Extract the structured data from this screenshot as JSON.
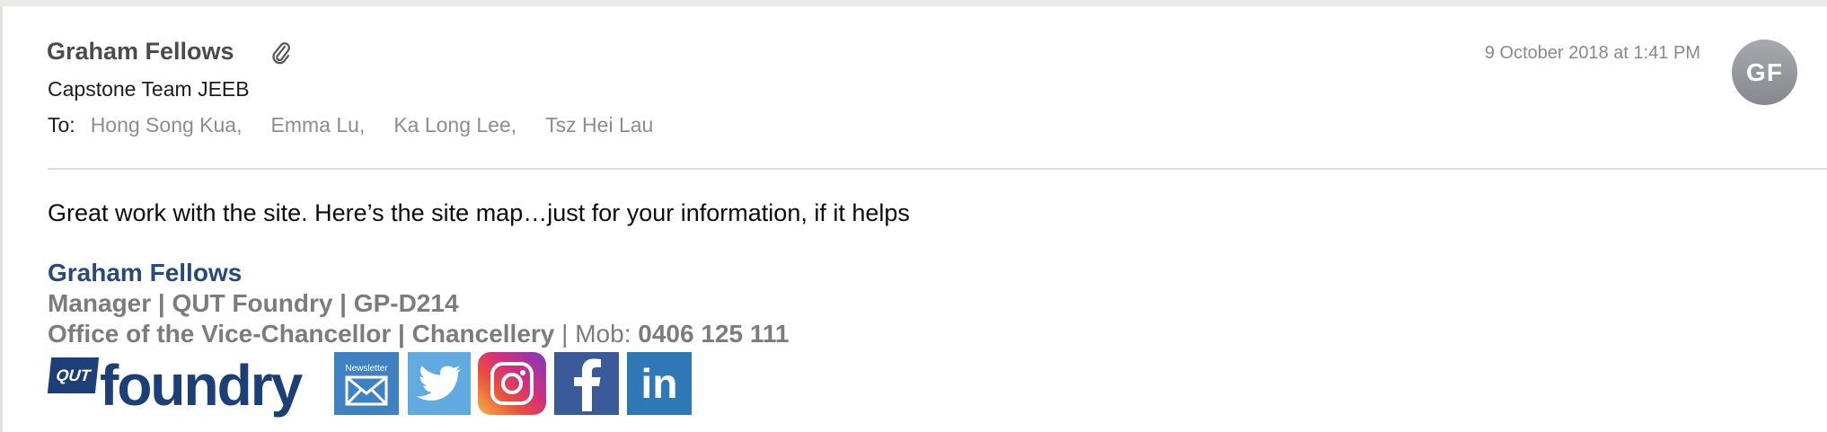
{
  "message": {
    "sender": "Graham Fellows",
    "subject": "Capstone Team JEEB",
    "to_label": "To:",
    "recipients": [
      "Hong Song Kua,",
      "Emma Lu,",
      "Ka Long Lee,",
      "Tsz Hei Lau"
    ],
    "date": "9 October 2018 at 1:41 PM",
    "avatar_initials": "GF",
    "body": "Great work with the site. Here’s the site map…just for your information, if it helps"
  },
  "signature": {
    "name": "Graham Fellows",
    "line1": "Manager | QUT Foundry | GP-D214",
    "line2_office": "Office of the Vice-Chancellor | Chancellery",
    "line2_sep": " | ",
    "mob_label": "Mob: ",
    "mob_number": "0406 125 111",
    "logo_badge": "QUT",
    "logo_word": "foundry",
    "newsletter_label": "Newsletter",
    "linkedin_label": "in"
  },
  "colors": {
    "signature_name": "#284a7b",
    "signature_text": "#7c7c7c",
    "avatar_bg": "#9a9ca1",
    "twitter": "#62abe0",
    "facebook": "#3a5a9a",
    "linkedin": "#2d78b5"
  },
  "icons": [
    "paperclip-icon",
    "newsletter-mail-icon",
    "twitter-icon",
    "instagram-icon",
    "facebook-icon",
    "linkedin-icon"
  ]
}
